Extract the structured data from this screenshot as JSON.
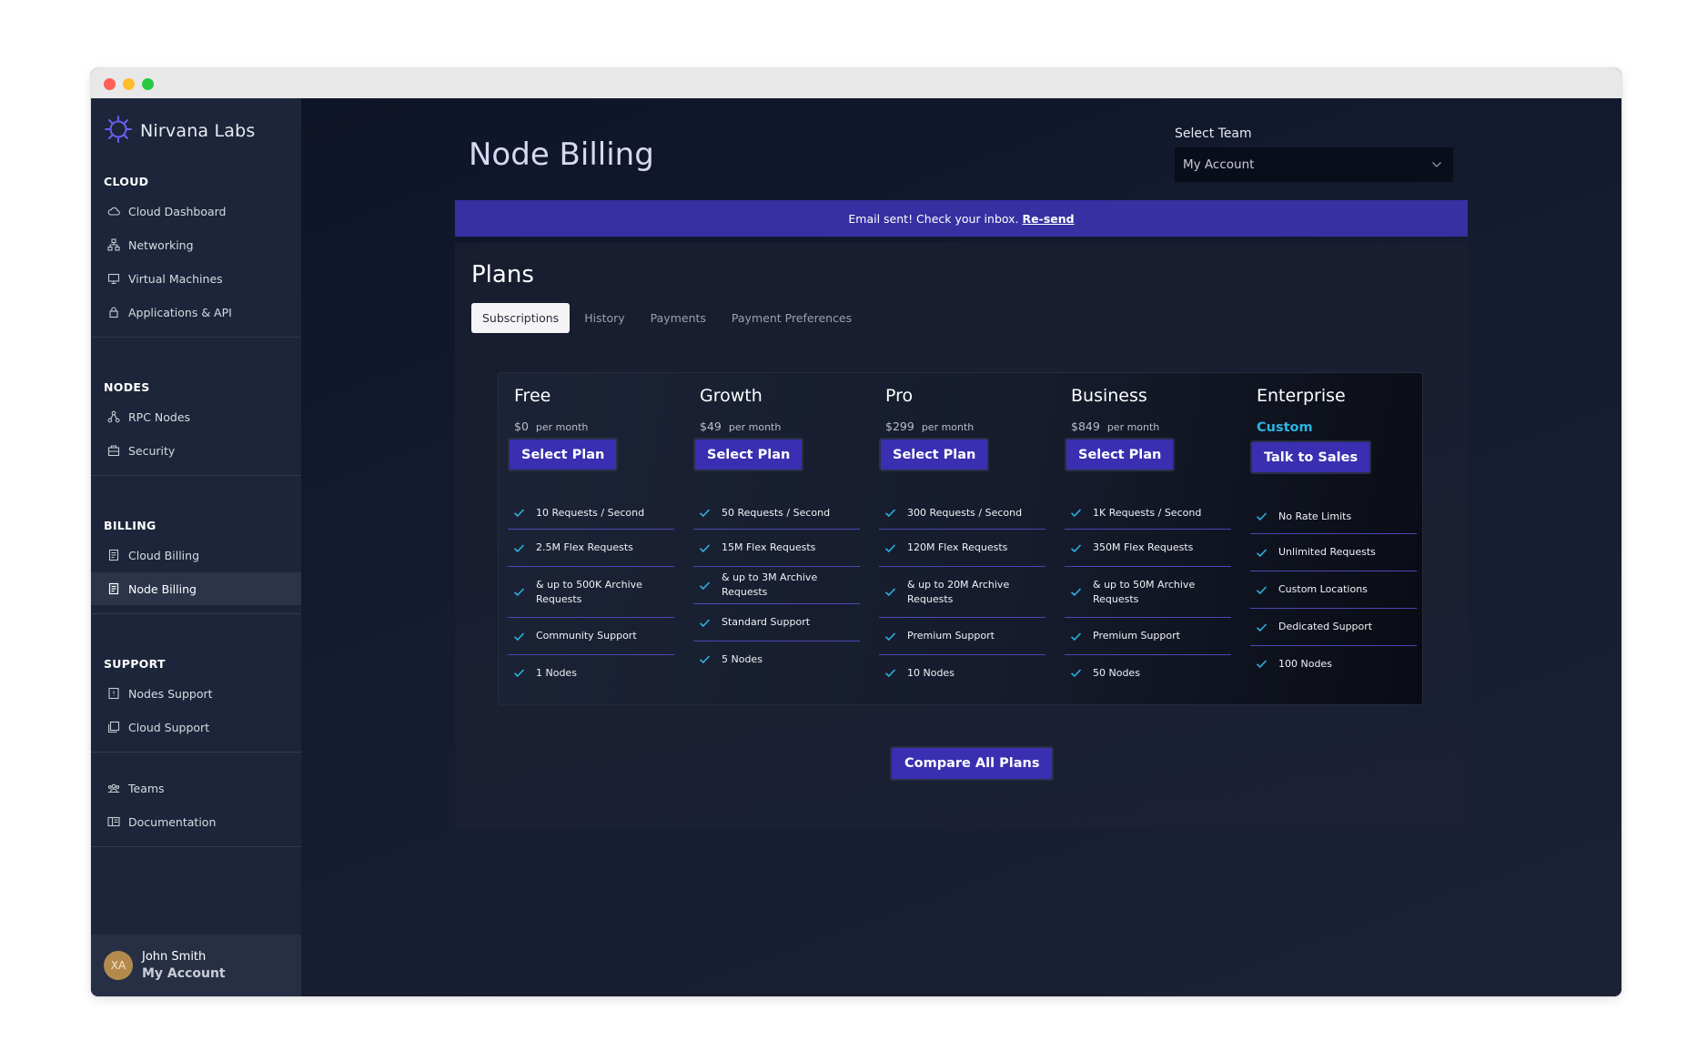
{
  "brand": {
    "name": "Nirvana Labs"
  },
  "sidebar": {
    "sections": [
      {
        "title": "CLOUD",
        "items": [
          {
            "label": "Cloud Dashboard",
            "icon": "cloud-icon"
          },
          {
            "label": "Networking",
            "icon": "network-icon"
          },
          {
            "label": "Virtual Machines",
            "icon": "monitor-icon"
          },
          {
            "label": "Applications & API",
            "icon": "lock-icon"
          }
        ]
      },
      {
        "title": "NODES",
        "items": [
          {
            "label": "RPC Nodes",
            "icon": "nodes-icon"
          },
          {
            "label": "Security",
            "icon": "security-icon"
          }
        ]
      },
      {
        "title": "BILLING",
        "items": [
          {
            "label": "Cloud Billing",
            "icon": "receipt-icon"
          },
          {
            "label": "Node Billing",
            "icon": "receipt-icon",
            "active": true
          }
        ]
      },
      {
        "title": "SUPPORT",
        "items": [
          {
            "label": "Nodes Support",
            "icon": "support-icon"
          },
          {
            "label": "Cloud Support",
            "icon": "support-icon"
          }
        ]
      },
      {
        "title": "",
        "items": [
          {
            "label": "Teams",
            "icon": "teams-icon"
          },
          {
            "label": "Documentation",
            "icon": "book-icon"
          }
        ]
      }
    ]
  },
  "user": {
    "initials": "XA",
    "name": "John Smith",
    "account": "My Account"
  },
  "header": {
    "title": "Node Billing",
    "team_label": "Select Team",
    "team_value": "My Account"
  },
  "banner": {
    "text": "Email sent! Check your inbox.",
    "link": "Re-send"
  },
  "plans": {
    "title": "Plans",
    "tabs": [
      {
        "label": "Subscriptions",
        "active": true
      },
      {
        "label": "History"
      },
      {
        "label": "Payments"
      },
      {
        "label": "Payment Preferences"
      }
    ],
    "tiers": [
      {
        "name": "Free",
        "price": "$0",
        "per": "per month",
        "button": "Select Plan",
        "features": [
          "10 Requests / Second",
          "2.5M Flex Requests",
          "& up to 500K Archive Requests",
          "Community Support",
          "1 Nodes"
        ]
      },
      {
        "name": "Growth",
        "price": "$49",
        "per": "per month",
        "button": "Select Plan",
        "features": [
          "50 Requests / Second",
          "15M Flex Requests",
          "& up to 3M Archive Requests",
          "Standard Support",
          "5 Nodes"
        ]
      },
      {
        "name": "Pro",
        "price": "$299",
        "per": "per month",
        "button": "Select Plan",
        "features": [
          "300 Requests / Second",
          "120M Flex Requests",
          "& up to 20M Archive Requests",
          "Premium Support",
          "10 Nodes"
        ]
      },
      {
        "name": "Business",
        "price": "$849",
        "per": "per month",
        "button": "Select Plan",
        "features": [
          "1K Requests / Second",
          "350M Flex Requests",
          "& up to 50M Archive Requests",
          "Premium Support",
          "50 Nodes"
        ]
      },
      {
        "name": "Enterprise",
        "custom": "Custom",
        "button": "Talk to Sales",
        "features": [
          "No Rate Limits",
          "Unlimited Requests",
          "Custom Locations",
          "Dedicated Support",
          "100 Nodes"
        ]
      }
    ],
    "compare_button": "Compare All Plans"
  },
  "colors": {
    "accent": "#3a2fb0",
    "banner": "#3730a3",
    "check": "#2bb3e0",
    "sidebar": "#1c2539"
  }
}
